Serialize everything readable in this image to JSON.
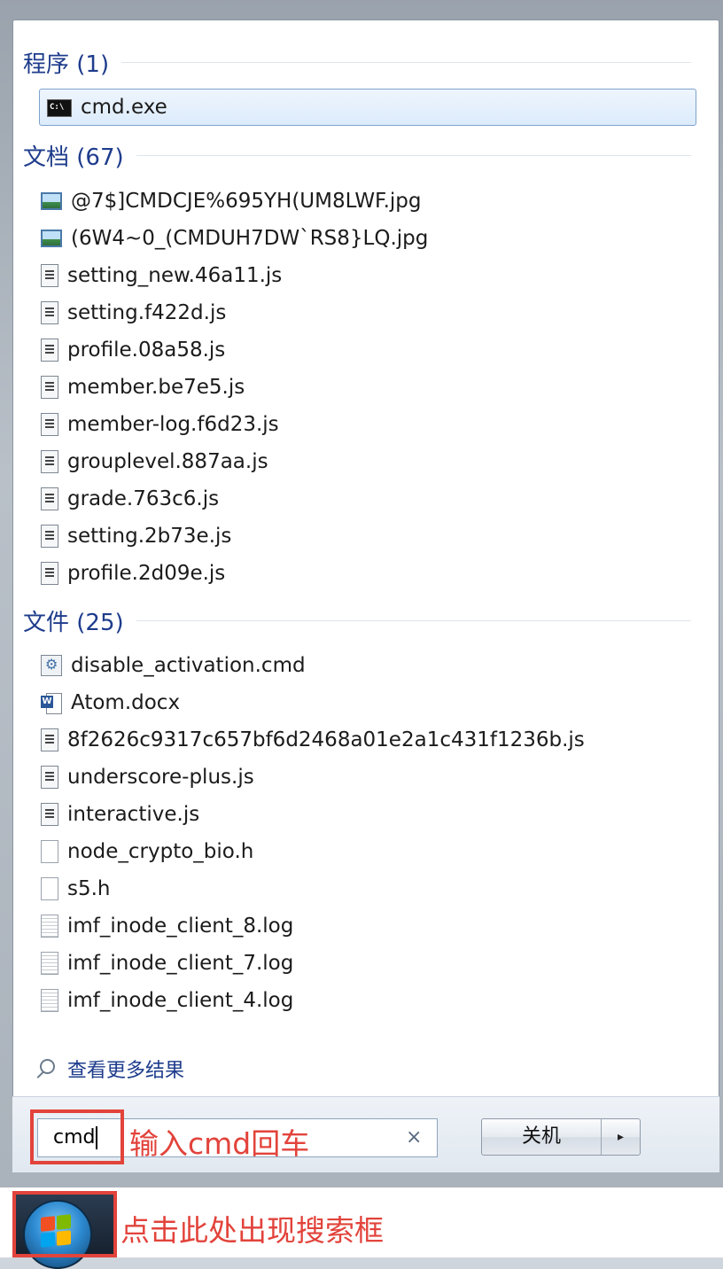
{
  "groups": {
    "programs": {
      "title": "程序 (1)",
      "items": [
        {
          "label": "cmd.exe",
          "icon": "cmd-icon"
        }
      ]
    },
    "documents": {
      "title": "文档 (67)",
      "items": [
        {
          "label": "@7$]CMDCJE%695YH(UM8LWF.jpg",
          "icon": "image-file-icon"
        },
        {
          "label": "(6W4~0_(CMDUH7DW`RS8}LQ.jpg",
          "icon": "image-file-icon"
        },
        {
          "label": "setting_new.46a11.js",
          "icon": "script-file-icon"
        },
        {
          "label": "setting.f422d.js",
          "icon": "script-file-icon"
        },
        {
          "label": "profile.08a58.js",
          "icon": "script-file-icon"
        },
        {
          "label": "member.be7e5.js",
          "icon": "script-file-icon"
        },
        {
          "label": "member-log.f6d23.js",
          "icon": "script-file-icon"
        },
        {
          "label": "grouplevel.887aa.js",
          "icon": "script-file-icon"
        },
        {
          "label": "grade.763c6.js",
          "icon": "script-file-icon"
        },
        {
          "label": "setting.2b73e.js",
          "icon": "script-file-icon"
        },
        {
          "label": "profile.2d09e.js",
          "icon": "script-file-icon"
        }
      ]
    },
    "files": {
      "title": "文件 (25)",
      "items": [
        {
          "label": "disable_activation.cmd",
          "icon": "batch-file-icon"
        },
        {
          "label": "Atom.docx",
          "icon": "word-document-icon"
        },
        {
          "label": "8f2626c9317c657bf6d2468a01e2a1c431f1236b.js",
          "icon": "script-file-icon"
        },
        {
          "label": "underscore-plus.js",
          "icon": "script-file-icon"
        },
        {
          "label": "interactive.js",
          "icon": "script-file-icon"
        },
        {
          "label": "node_crypto_bio.h",
          "icon": "blank-file-icon"
        },
        {
          "label": "s5.h",
          "icon": "blank-file-icon"
        },
        {
          "label": "imf_inode_client_8.log",
          "icon": "log-file-icon"
        },
        {
          "label": "imf_inode_client_7.log",
          "icon": "log-file-icon"
        },
        {
          "label": "imf_inode_client_4.log",
          "icon": "log-file-icon"
        }
      ]
    }
  },
  "see_more": {
    "label": "查看更多结果",
    "icon": "magnifier-icon"
  },
  "search": {
    "value": "cmd",
    "clear_icon": "×"
  },
  "annotations": {
    "search_hint": "输入cmd回车",
    "start_hint": "点击此处出现搜索框"
  },
  "shutdown": {
    "label": "关机",
    "arrow": "▸"
  },
  "colors": {
    "group_title": "#1e3c8c",
    "annotation_red": "#e2433b",
    "selected_border": "#7da2ce",
    "flag_red": "#f25022",
    "flag_green": "#7fba00",
    "flag_blue": "#00a4ef",
    "flag_yellow": "#ffb900"
  }
}
